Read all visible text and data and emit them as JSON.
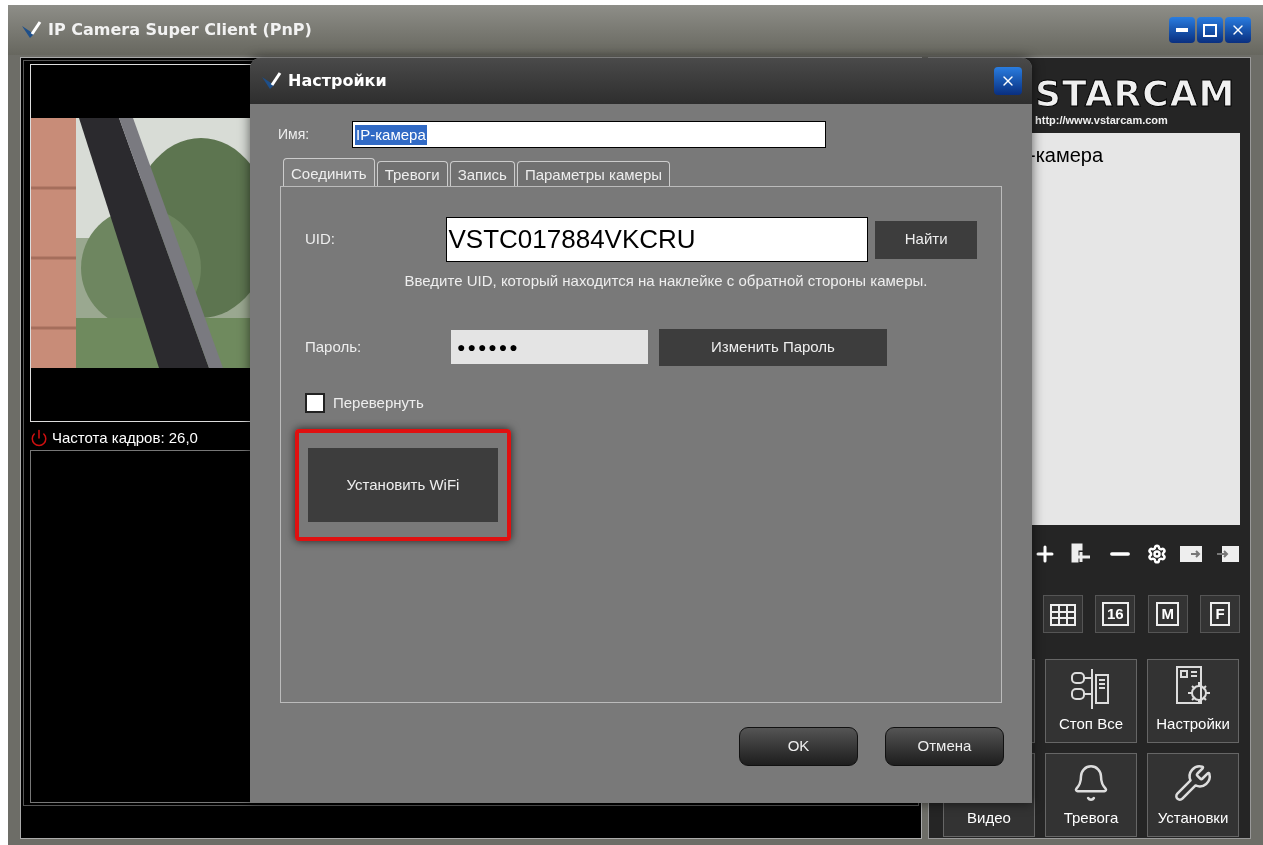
{
  "window": {
    "title": "IP Camera Super Client (PnP)"
  },
  "camera_tile": {
    "frame_rate": "Частота кадров: 26,0"
  },
  "logo": {
    "name": "STARCAM",
    "url": "http://www.vstarcam.com"
  },
  "camera_list": {
    "items": [
      {
        "label": "-камера"
      }
    ]
  },
  "list_toolbar": [
    {
      "kind": "add"
    },
    {
      "kind": "add-group"
    },
    {
      "kind": "remove"
    },
    {
      "kind": "settings"
    },
    {
      "kind": "export"
    },
    {
      "kind": "import"
    }
  ],
  "view_buttons": [
    {
      "kind": "grid"
    },
    {
      "kind": "text",
      "label": "16"
    },
    {
      "kind": "text",
      "label": "M"
    },
    {
      "kind": "text",
      "label": "F"
    }
  ],
  "action_buttons": [
    {
      "kind": "stop",
      "label": "Стоп Все"
    },
    {
      "kind": "settings",
      "label": "Настройки"
    },
    {
      "kind": "video",
      "label": "Видео"
    },
    {
      "kind": "alarm",
      "label": "Тревога"
    },
    {
      "kind": "tools",
      "label": "Установки"
    }
  ],
  "dialog": {
    "title": "Настройки",
    "name_label": "Имя:",
    "name_value": "IP-камера",
    "name_selected": true,
    "tabs": [
      {
        "label": "Соединить",
        "selected": true
      },
      {
        "label": "Тревоги",
        "selected": false
      },
      {
        "label": "Запись",
        "selected": false
      },
      {
        "label": "Параметры камеры",
        "selected": false
      }
    ],
    "uid_label": "UID:",
    "uid_value": "VSTC017884VKCRU",
    "find_button": "Найти",
    "hint": "Введите UID, который находится на наклейке с обратной стороны камеры.",
    "password_label": "Пароль:",
    "password_value": "●●●●●●",
    "change_password_button": "Изменить Пароль",
    "flip": {
      "label": "Перевернуть",
      "checked": false
    },
    "wifi_button": {
      "label": "Установить WiFi",
      "highlighted": true
    },
    "ok_button": "OK",
    "cancel_button": "Отмена"
  }
}
